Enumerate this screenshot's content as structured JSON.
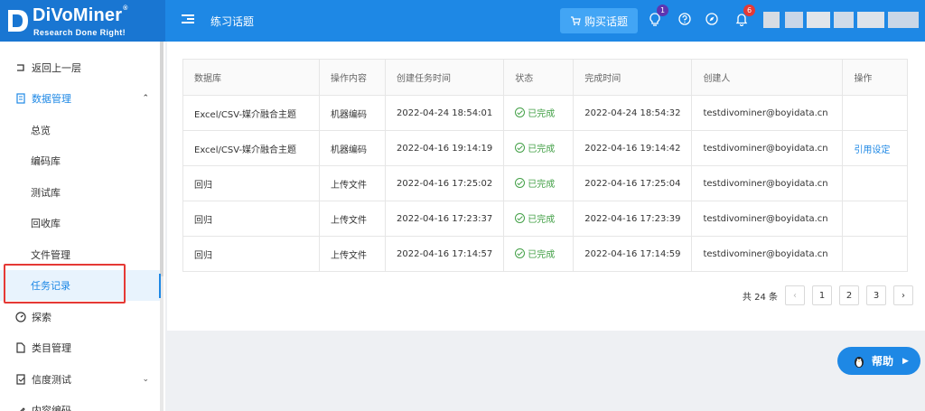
{
  "brand": {
    "name": "DiVoMiner",
    "slogan": "Research Done Right!"
  },
  "header": {
    "title": "练习话题",
    "buy_label": "购买话题",
    "notif_badge_1": "1",
    "notif_badge_2": "6"
  },
  "sidebar": {
    "back": "返回上一层",
    "data_mgmt": "数据管理",
    "overview": "总览",
    "coding_lib": "编码库",
    "test_lib": "测试库",
    "recycle_lib": "回收库",
    "file_mgmt": "文件管理",
    "task_log": "任务记录",
    "explore": "探索",
    "category_mgmt": "类目管理",
    "reliability_test": "信度测试",
    "content_coding": "内容编码"
  },
  "table": {
    "headers": [
      "数据库",
      "操作内容",
      "创建任务时间",
      "状态",
      "完成时间",
      "创建人",
      "操作"
    ],
    "rows": [
      {
        "db": "Excel/CSV-媒介融合主题",
        "op": "机器编码",
        "created": "2022-04-24 18:54:01",
        "status": "已完成",
        "finished": "2022-04-24 18:54:32",
        "creator": "testdivominer@boyidata.cn",
        "action": ""
      },
      {
        "db": "Excel/CSV-媒介融合主题",
        "op": "机器编码",
        "created": "2022-04-16 19:14:19",
        "status": "已完成",
        "finished": "2022-04-16 19:14:42",
        "creator": "testdivominer@boyidata.cn",
        "action": "引用设定"
      },
      {
        "db": "回归",
        "op": "上传文件",
        "created": "2022-04-16 17:25:02",
        "status": "已完成",
        "finished": "2022-04-16 17:25:04",
        "creator": "testdivominer@boyidata.cn",
        "action": ""
      },
      {
        "db": "回归",
        "op": "上传文件",
        "created": "2022-04-16 17:23:37",
        "status": "已完成",
        "finished": "2022-04-16 17:23:39",
        "creator": "testdivominer@boyidata.cn",
        "action": ""
      },
      {
        "db": "回归",
        "op": "上传文件",
        "created": "2022-04-16 17:14:57",
        "status": "已完成",
        "finished": "2022-04-16 17:14:59",
        "creator": "testdivominer@boyidata.cn",
        "action": ""
      }
    ]
  },
  "pagination": {
    "total": "共 24 条",
    "pages": [
      "1",
      "2",
      "3"
    ],
    "prev": "‹",
    "next": "›"
  },
  "help": {
    "label": "帮助"
  },
  "colors": {
    "accent": "#1e88e5",
    "success": "#43a047",
    "highlight": "#e53935"
  }
}
